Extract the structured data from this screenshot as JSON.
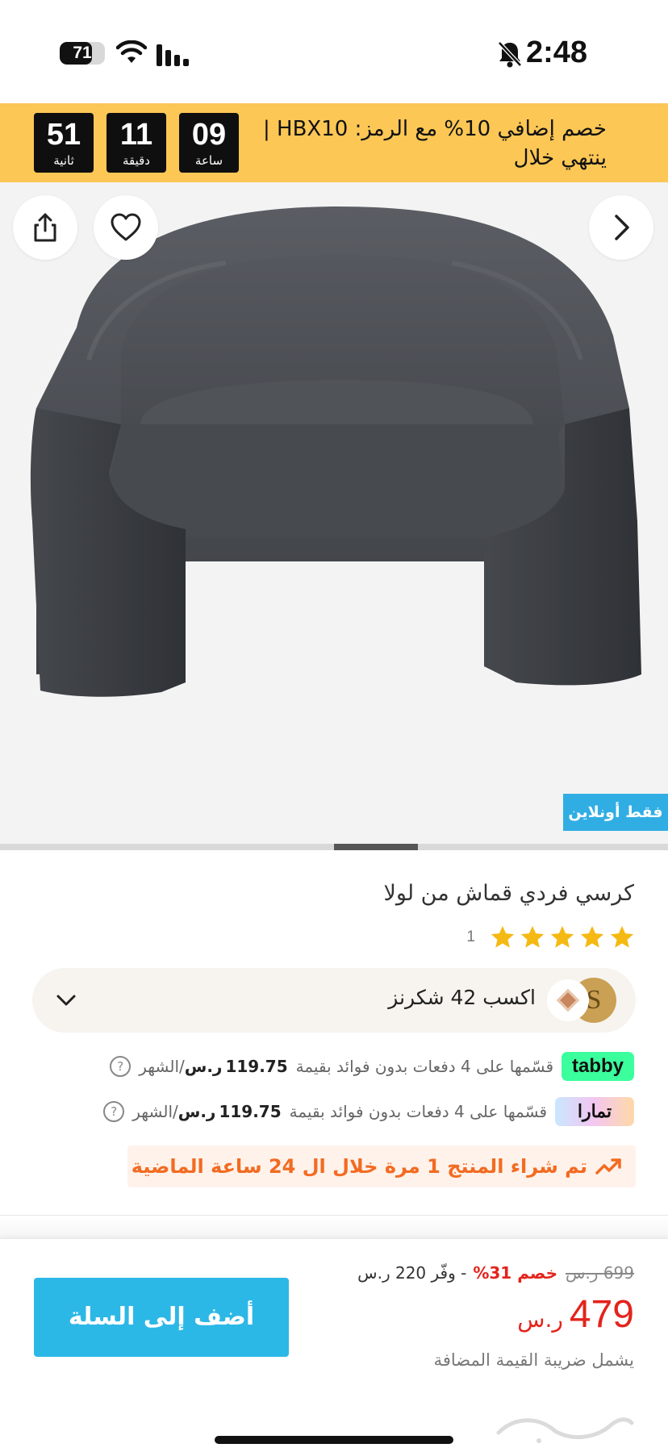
{
  "status_bar": {
    "battery_level": "71",
    "battery_fraction": 0.71,
    "time": "2:48",
    "icons": [
      "battery-icon",
      "wifi-icon",
      "signal-icon",
      "bell-slash-icon"
    ]
  },
  "promo": {
    "text_line1": "خصم إضافي 10% مع الرمز: HBX10 |",
    "text_line2": "ينتهي خلال",
    "timers": [
      {
        "value": "09",
        "label": "ساعة"
      },
      {
        "value": "11",
        "label": "دقيقة"
      },
      {
        "value": "51",
        "label": "ثانية"
      }
    ],
    "background_color": "#fcc755"
  },
  "gallery": {
    "badge": "فقط أونلاين",
    "icons": [
      "share-icon",
      "heart-icon",
      "chevron-right-icon"
    ],
    "carousel_position": 0.5
  },
  "product": {
    "title": "كرسي فردي قماش من لولا",
    "rating": 5,
    "review_count": "1"
  },
  "shukran": {
    "text": "اكسب 42 شكرنز",
    "coin_letter": "S"
  },
  "installments": [
    {
      "provider": "tabby",
      "logo_text": "tabby",
      "description": "قسّمها على 4 دفعات بدون فوائد بقيمة",
      "amount": "119.75",
      "currency": "ر.س",
      "period": "/الشهر"
    },
    {
      "provider": "tamara",
      "logo_text": "تمارا",
      "description": "قسّمها على 4 دفعات بدون فوائد بقيمة",
      "amount": "119.75",
      "currency": "ر.س",
      "period": "/الشهر"
    }
  ],
  "social_proof": {
    "text": "تم شراء المنتج 1 مرة خلال ال 24 ساعة الماضية"
  },
  "pricing": {
    "old_price": "699 ر.س",
    "discount": "خصم 31%",
    "save_text": "- وفّر 220 ر.س",
    "price": "479",
    "currency": "ر.س",
    "vat_note": "يشمل ضريبة القيمة المضافة"
  },
  "cart": {
    "add_label": "أضف إلى السلة",
    "color": "#2cb8e6"
  },
  "colors": {
    "accent_red": "#e4231b",
    "online_badge": "#30aee4",
    "social_proof": "#f26b22"
  }
}
